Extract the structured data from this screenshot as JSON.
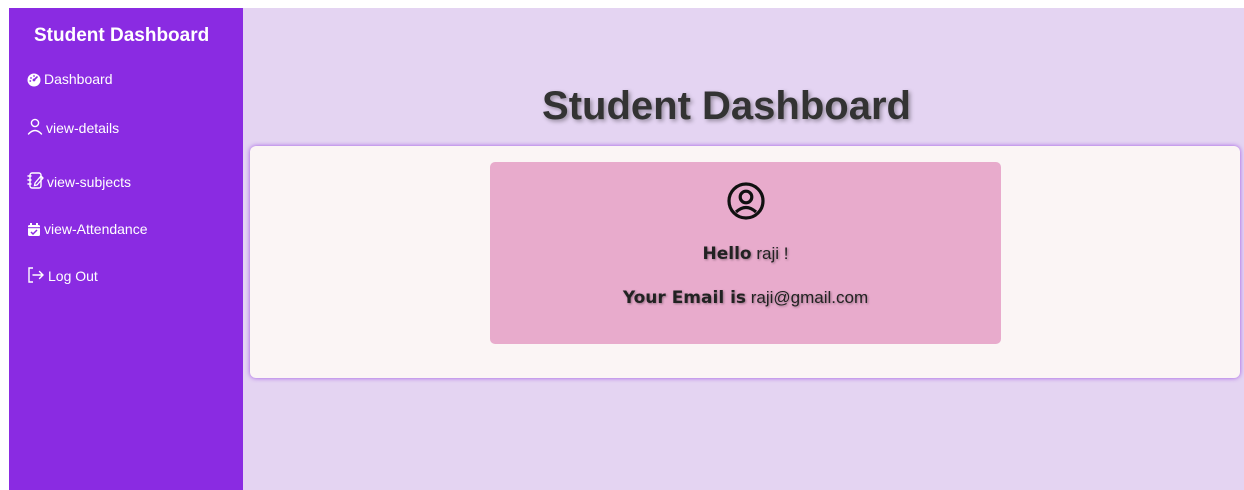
{
  "sidebar": {
    "title": "Student Dashboard",
    "items": [
      {
        "label": "Dashboard",
        "icon": "dashboard-gauge-icon"
      },
      {
        "label": "view-details",
        "icon": "user-outline-icon"
      },
      {
        "label": "view-subjects",
        "icon": "notebook-edit-icon"
      },
      {
        "label": "view-Attendance",
        "icon": "calendar-check-icon"
      },
      {
        "label": "Log Out",
        "icon": "logout-arrow-icon"
      }
    ]
  },
  "main": {
    "title": "Student Dashboard",
    "profile": {
      "icon": "user-circle-icon",
      "greeting_prefix": "Hello",
      "name": "raji !",
      "email_prefix": "Your Email is",
      "email": "raji@gmail.com"
    }
  },
  "colors": {
    "sidebar": "#8a2be2",
    "background": "#e4d4f2",
    "card": "#fbf5f5",
    "profile_box": "#e8abcc"
  }
}
